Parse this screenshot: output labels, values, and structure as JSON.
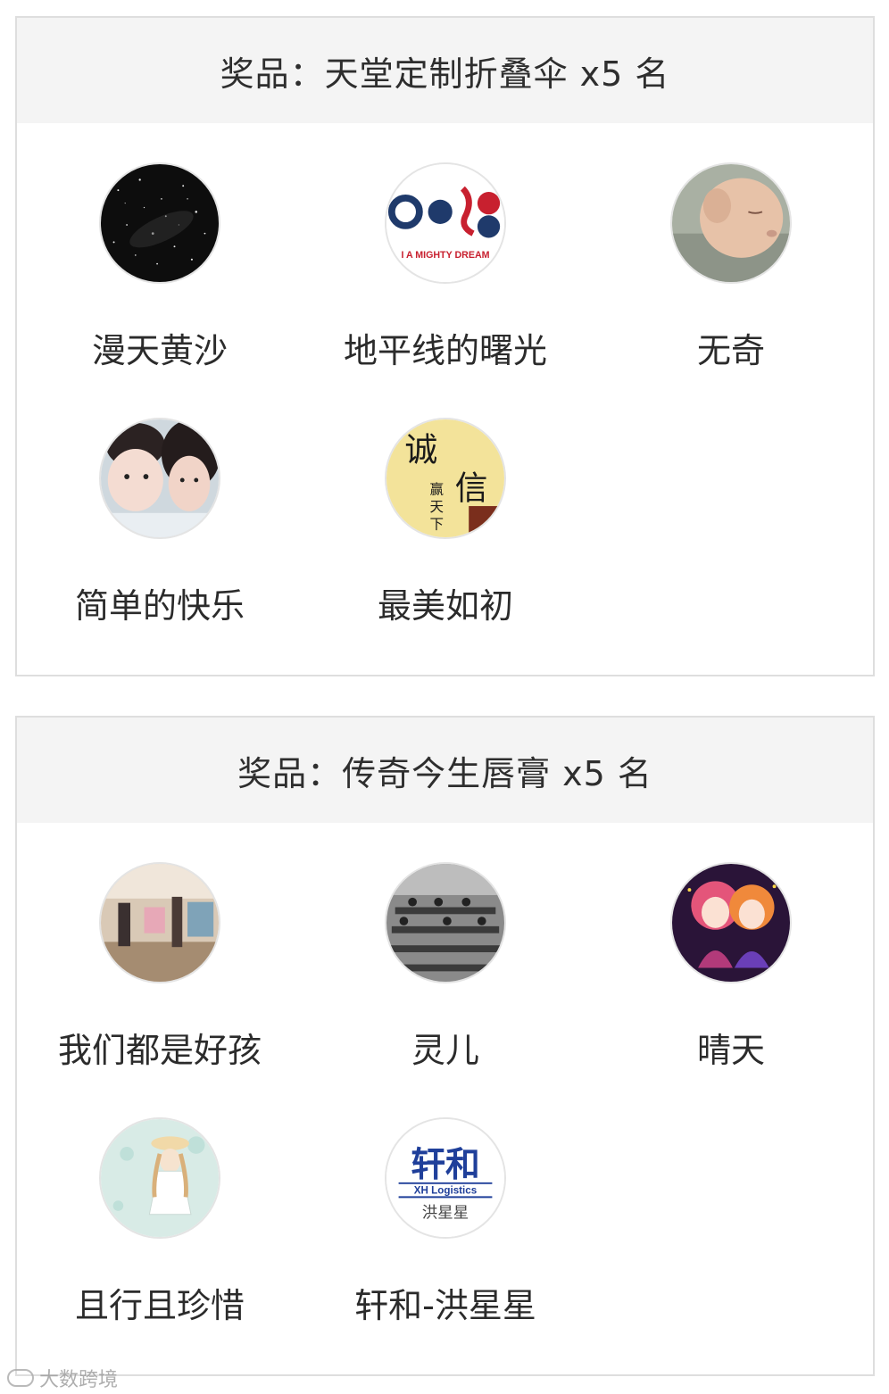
{
  "sections": [
    {
      "title": "奖品：天堂定制折叠伞 x5 名",
      "winners": [
        {
          "name": "漫天黄沙",
          "avatar": "starry-sky-avatar"
        },
        {
          "name": "地平线的曙光",
          "avatar": "mighty-dream-logo-avatar",
          "avatar_text": "I A MIGHTY DREAM"
        },
        {
          "name": "无奇",
          "avatar": "sleeping-baby-avatar"
        },
        {
          "name": "简单的快乐",
          "avatar": "mother-child-selfie-avatar"
        },
        {
          "name": "最美如初",
          "avatar": "calligraphy-avatar",
          "avatar_text": [
            "诚",
            "信",
            "赢",
            "天",
            "下"
          ]
        }
      ]
    },
    {
      "title": "奖品：传奇今生唇膏 x5 名",
      "winners": [
        {
          "name": "我们都是好孩",
          "avatar": "store-interior-avatar"
        },
        {
          "name": "灵儿",
          "avatar": "bw-classroom-avatar"
        },
        {
          "name": "晴天",
          "avatar": "anime-girls-avatar"
        },
        {
          "name": "且行且珍惜",
          "avatar": "anime-girl-umbrella-avatar"
        },
        {
          "name": "轩和-洪星星",
          "avatar": "xh-logistics-logo-avatar",
          "avatar_text": [
            "轩和",
            "XH Logistics",
            "洪星星"
          ]
        }
      ]
    }
  ],
  "watermark": {
    "text": "大数跨境",
    "icon": "logo-icon"
  }
}
